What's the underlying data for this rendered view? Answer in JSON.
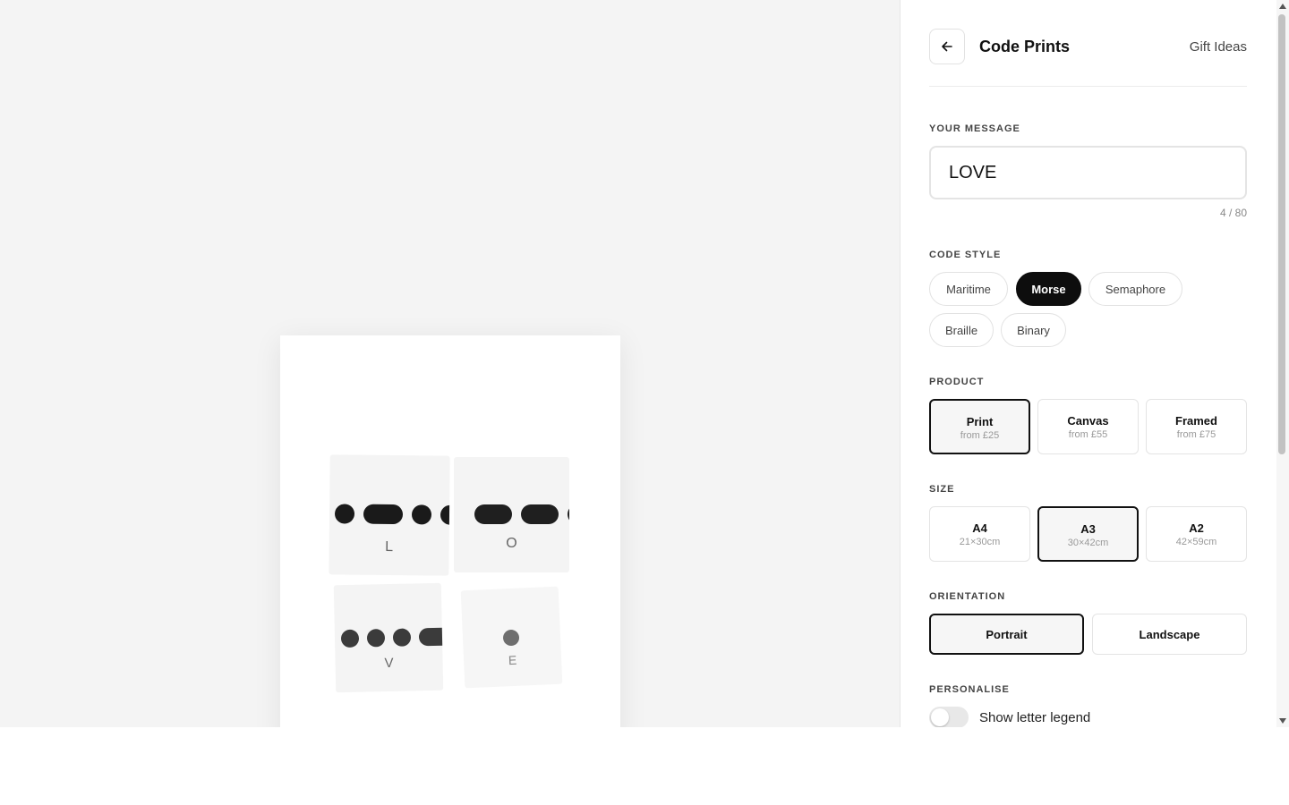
{
  "header": {
    "back_icon": "arrow-left-icon",
    "title": "Code Prints",
    "link": "Gift Ideas"
  },
  "message": {
    "label": "YOUR MESSAGE",
    "value": "LOVE",
    "counter": "4 / 80"
  },
  "code_style": {
    "label": "CODE STYLE",
    "options": [
      "Maritime",
      "Morse",
      "Semaphore",
      "Braille",
      "Binary"
    ],
    "selected": "Morse"
  },
  "product": {
    "label": "PRODUCT",
    "options": [
      {
        "title": "Print",
        "sub": "from £25"
      },
      {
        "title": "Canvas",
        "sub": "from £55"
      },
      {
        "title": "Framed",
        "sub": "from £75"
      }
    ],
    "selected": "Print"
  },
  "size": {
    "label": "SIZE",
    "options": [
      {
        "title": "A4",
        "sub": "21×30cm"
      },
      {
        "title": "A3",
        "sub": "30×42cm"
      },
      {
        "title": "A2",
        "sub": "42×59cm"
      }
    ],
    "selected": "A3"
  },
  "orientation": {
    "label": "ORIENTATION",
    "options": [
      "Portrait",
      "Landscape"
    ],
    "selected": "Portrait"
  },
  "personalise": {
    "label": "PERSONALISE",
    "legend_toggle_label": "Show letter legend",
    "legend_on": false
  },
  "preview": {
    "tiles": [
      {
        "letter": "L",
        "morse": ".-.."
      },
      {
        "letter": "O",
        "morse": "---"
      },
      {
        "letter": "V",
        "morse": "...-"
      },
      {
        "letter": "E",
        "morse": "."
      }
    ],
    "colors": {
      "ink_1": "#1a1a1a",
      "ink_2": "#1f1f1f",
      "ink_3": "#3b3b3b",
      "ink_4": "#6e6e6e"
    }
  }
}
